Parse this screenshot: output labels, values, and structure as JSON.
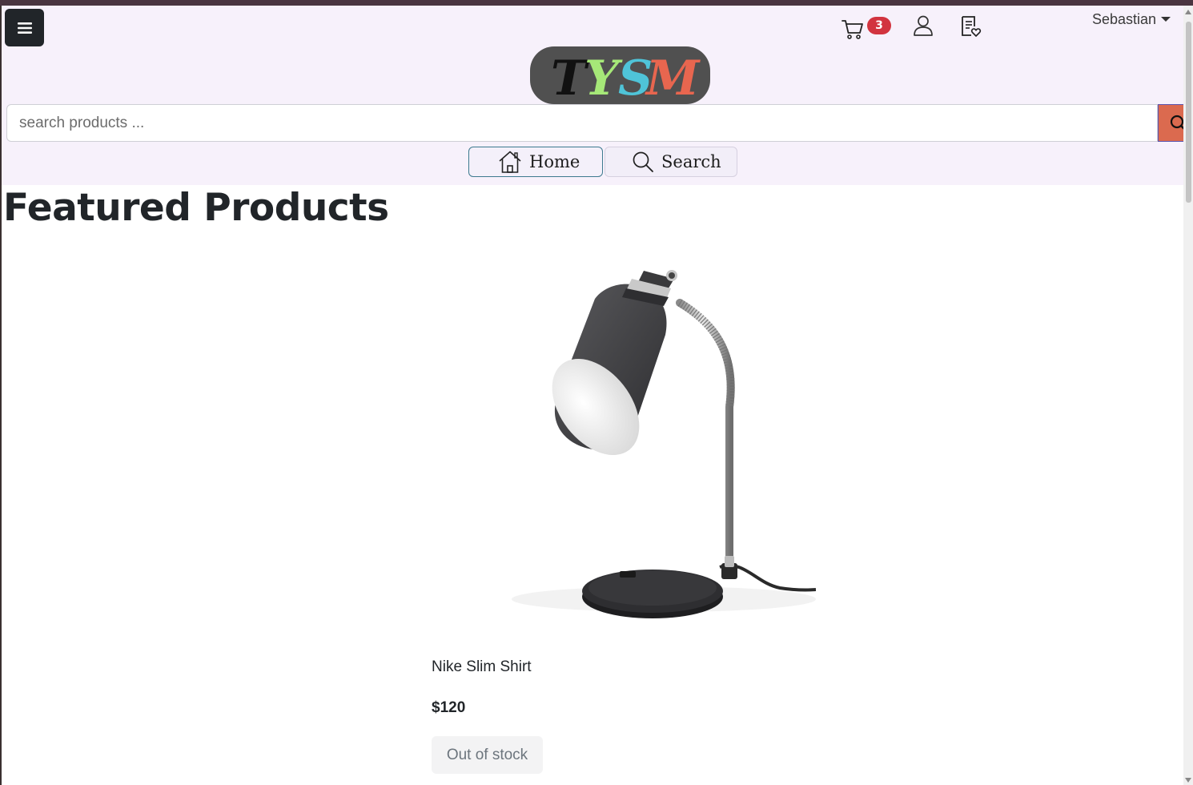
{
  "header": {
    "menu_icon": "hamburger-icon",
    "cart": {
      "icon": "cart-icon",
      "count": "3"
    },
    "account_icon": "user-icon",
    "wishlist_icon": "wishlist-icon",
    "user_name": "Sebastian",
    "logo_text": "TYSM"
  },
  "search": {
    "placeholder": "search products ...",
    "value": "",
    "button_icon": "search-icon"
  },
  "nav": {
    "home_label": "Home",
    "home_icon": "home-icon",
    "search_label": "Search",
    "search_icon": "search-icon"
  },
  "main": {
    "title": "Featured Products",
    "products": [
      {
        "name": "Nike Slim Shirt",
        "price": "$120",
        "stock_label": "Out of stock",
        "image": "desk-lamp-image"
      }
    ]
  },
  "colors": {
    "header_bg": "#f7f1fb",
    "menu_button": "#212529",
    "badge": "#d2343f",
    "search_button": "#db6a4f",
    "logo_bg": "#505050"
  }
}
